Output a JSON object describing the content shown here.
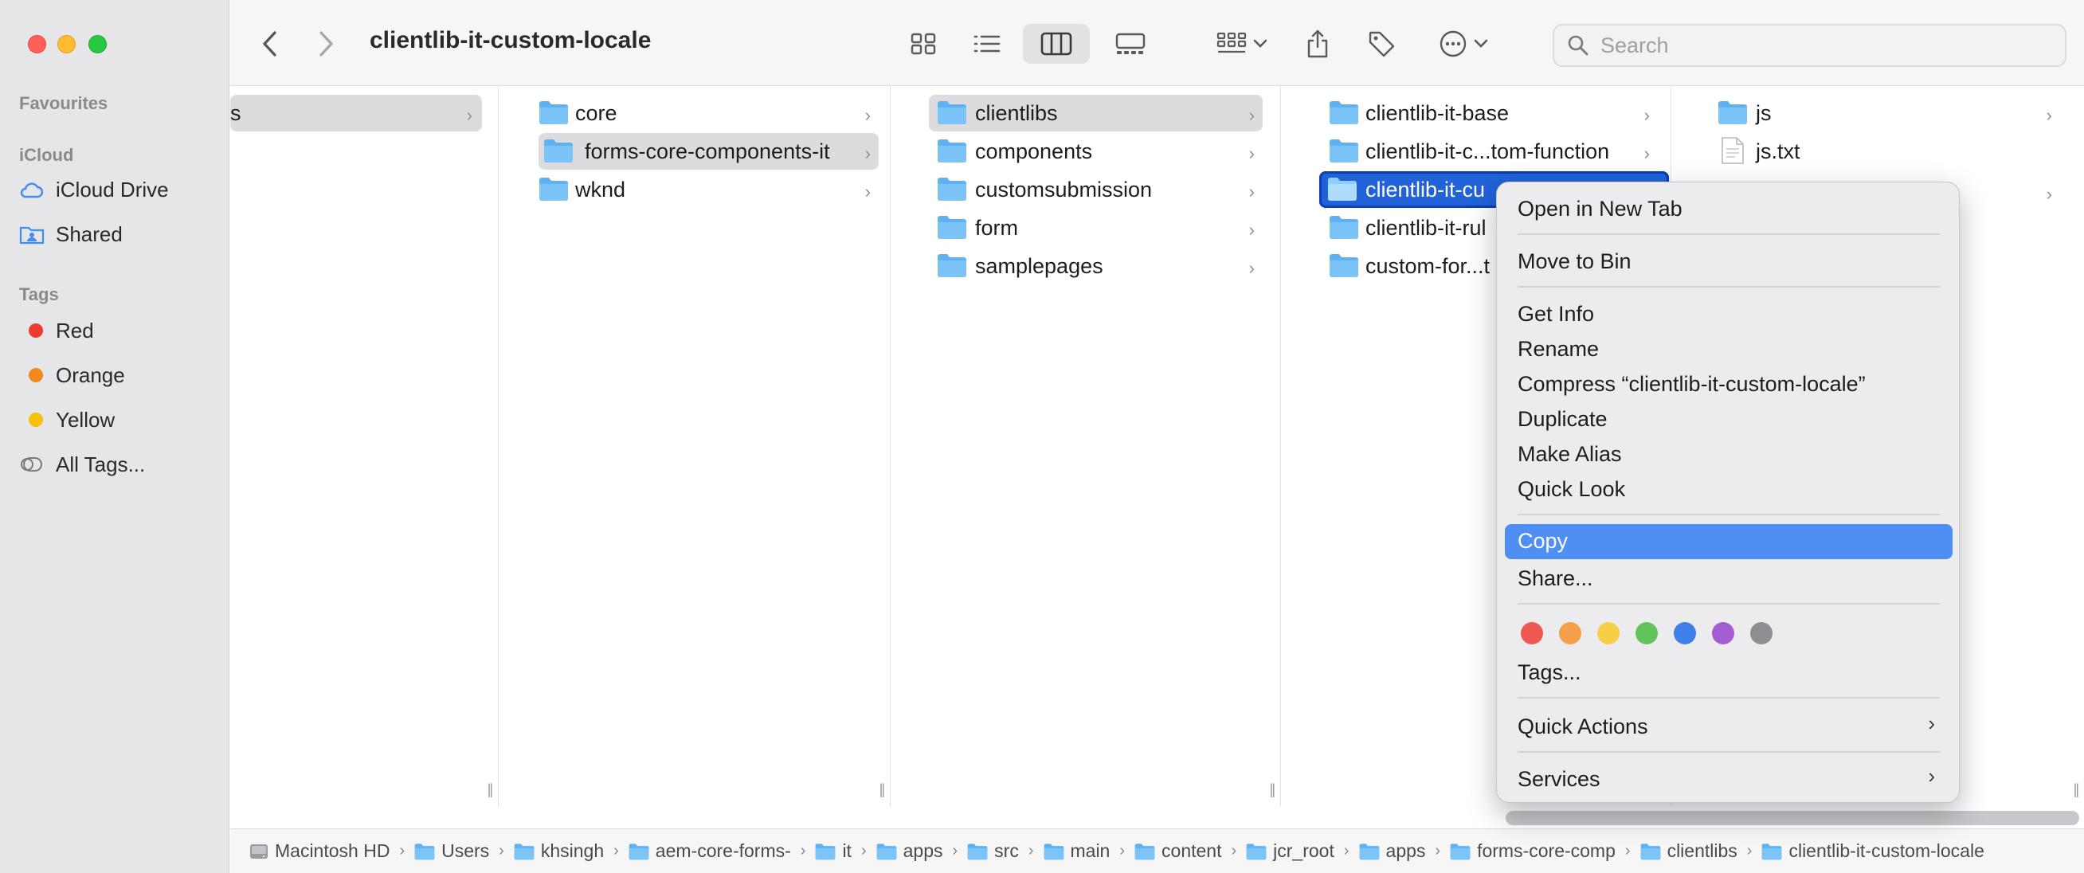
{
  "window": {
    "title": "clientlib-it-custom-locale"
  },
  "sidebar": {
    "favourites_label": "Favourites",
    "icloud_label": "iCloud",
    "icloud_items": [
      {
        "label": "iCloud Drive"
      },
      {
        "label": "Shared"
      }
    ],
    "tags_label": "Tags",
    "tags": [
      {
        "label": "Red",
        "color": "#ee3b32"
      },
      {
        "label": "Orange",
        "color": "#f08a1c"
      },
      {
        "label": "Yellow",
        "color": "#f4c20d"
      },
      {
        "label": "All Tags..."
      }
    ]
  },
  "search": {
    "placeholder": "Search"
  },
  "columns": {
    "col0": {
      "items": [
        {
          "label": "s"
        }
      ]
    },
    "col1": {
      "items": [
        {
          "label": "core"
        },
        {
          "label": "forms-core-components-it"
        },
        {
          "label": "wknd"
        }
      ]
    },
    "col2": {
      "items": [
        {
          "label": "clientlibs"
        },
        {
          "label": "components"
        },
        {
          "label": "customsubmission"
        },
        {
          "label": "form"
        },
        {
          "label": "samplepages"
        }
      ]
    },
    "col3": {
      "items": [
        {
          "label": "clientlib-it-base"
        },
        {
          "label": "clientlib-it-c...tom-function"
        },
        {
          "label": "clientlib-it-cu"
        },
        {
          "label": "clientlib-it-rul"
        },
        {
          "label": "custom-for...t"
        }
      ]
    },
    "col4": {
      "items": [
        {
          "label": "js"
        },
        {
          "label": "js.txt"
        }
      ]
    }
  },
  "pathbar": {
    "crumbs": [
      "Macintosh HD",
      "Users",
      "khsingh",
      "aem-core-forms-",
      "it",
      "apps",
      "src",
      "main",
      "content",
      "jcr_root",
      "apps",
      "forms-core-comp",
      "clientlibs",
      "clientlib-it-custom-locale"
    ]
  },
  "context_menu": {
    "open_new_tab": "Open in New Tab",
    "move_to_bin": "Move to Bin",
    "get_info": "Get Info",
    "rename": "Rename",
    "compress": "Compress “clientlib-it-custom-locale”",
    "duplicate": "Duplicate",
    "make_alias": "Make Alias",
    "quick_look": "Quick Look",
    "copy": "Copy",
    "share": "Share...",
    "tag_colors": [
      "#ee5a52",
      "#f4a04a",
      "#f6cf47",
      "#62c35a",
      "#3f7fe8",
      "#a45cd2",
      "#8e8e92"
    ],
    "tags": "Tags...",
    "quick_actions": "Quick Actions",
    "services": "Services"
  }
}
